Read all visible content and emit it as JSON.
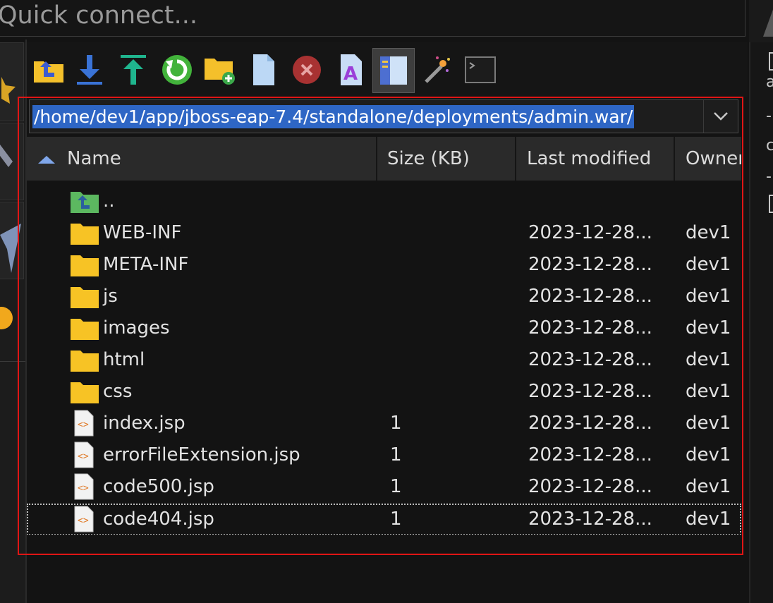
{
  "quick_connect": {
    "placeholder": "Quick connect..."
  },
  "toolbar": {
    "buttons": [
      {
        "name": "parent-directory-button",
        "icon": "folder-up-icon"
      },
      {
        "name": "download-button",
        "icon": "download-arrow-icon"
      },
      {
        "name": "upload-button",
        "icon": "upload-arrow-icon"
      },
      {
        "name": "refresh-button",
        "icon": "refresh-icon"
      },
      {
        "name": "new-folder-button",
        "icon": "new-folder-icon"
      },
      {
        "name": "new-file-button",
        "icon": "new-file-icon"
      },
      {
        "name": "delete-button",
        "icon": "delete-icon"
      },
      {
        "name": "rename-button",
        "icon": "rename-icon"
      },
      {
        "name": "toggle-panel-button",
        "icon": "panel-icon",
        "active": true
      },
      {
        "name": "magic-wand-button",
        "icon": "magic-wand-icon"
      },
      {
        "name": "terminal-button",
        "icon": "terminal-icon"
      }
    ]
  },
  "path": {
    "value": "/home/dev1/app/jboss-eap-7.4/standalone/deployments/admin.war/"
  },
  "columns": {
    "name": "Name",
    "size": "Size (KB)",
    "modified": "Last modified",
    "owner": "Owner"
  },
  "rows": [
    {
      "type": "parent",
      "name": "..",
      "size": "",
      "modified": "",
      "owner": ""
    },
    {
      "type": "folder",
      "name": "WEB-INF",
      "size": "",
      "modified": "2023-12-28...",
      "owner": "dev1"
    },
    {
      "type": "folder",
      "name": "META-INF",
      "size": "",
      "modified": "2023-12-28...",
      "owner": "dev1"
    },
    {
      "type": "folder",
      "name": "js",
      "size": "",
      "modified": "2023-12-28...",
      "owner": "dev1"
    },
    {
      "type": "folder",
      "name": "images",
      "size": "",
      "modified": "2023-12-28...",
      "owner": "dev1"
    },
    {
      "type": "folder",
      "name": "html",
      "size": "",
      "modified": "2023-12-28...",
      "owner": "dev1"
    },
    {
      "type": "folder",
      "name": "css",
      "size": "",
      "modified": "2023-12-28...",
      "owner": "dev1"
    },
    {
      "type": "file",
      "name": "index.jsp",
      "size": "1",
      "modified": "2023-12-28...",
      "owner": "dev1"
    },
    {
      "type": "file",
      "name": "errorFileExtension.jsp",
      "size": "1",
      "modified": "2023-12-28...",
      "owner": "dev1"
    },
    {
      "type": "file",
      "name": "code500.jsp",
      "size": "1",
      "modified": "2023-12-28...",
      "owner": "dev1"
    },
    {
      "type": "file",
      "name": "code404.jsp",
      "size": "1",
      "modified": "2023-12-28...",
      "owner": "dev1",
      "focused": true
    }
  ],
  "colors": {
    "selection": "#2e66c5",
    "folder": "#f7c325",
    "highlight_frame": "#e01515",
    "header_bg": "#2a2a2a"
  }
}
